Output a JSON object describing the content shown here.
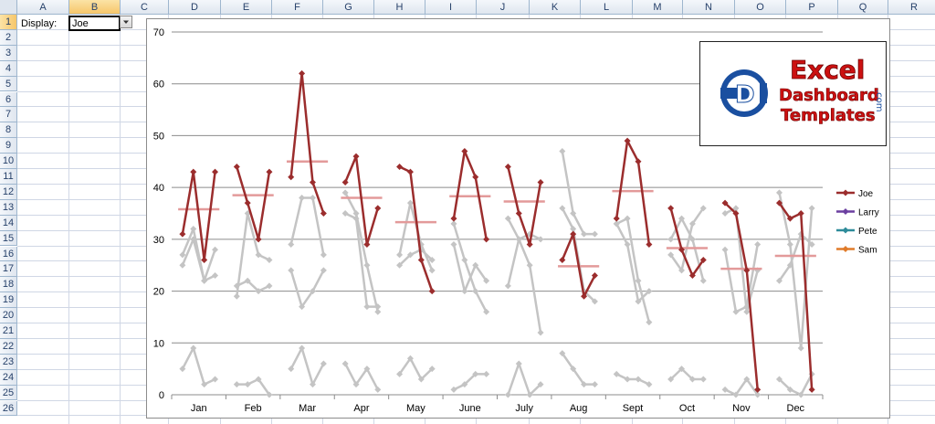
{
  "columns": [
    "A",
    "B",
    "C",
    "D",
    "E",
    "F",
    "G",
    "H",
    "I",
    "J",
    "K",
    "L",
    "M",
    "N",
    "O",
    "P",
    "Q",
    "R"
  ],
  "rows": [
    "1",
    "2",
    "3",
    "4",
    "5",
    "6",
    "7",
    "8",
    "9",
    "10",
    "11",
    "12",
    "13",
    "14",
    "15",
    "16",
    "17",
    "18",
    "19",
    "20",
    "21",
    "22",
    "23",
    "24",
    "25",
    "26"
  ],
  "active_column": "B",
  "active_row": "1",
  "cells": {
    "a1_label": "Display:",
    "b1_value": "Joe"
  },
  "dropdown_icon": "chevron-down-icon",
  "logo": {
    "line1": "Excel",
    "line2": "Dashboard",
    "line3": "Templates",
    "dotcom": ".com"
  },
  "colors": {
    "joe": "#9b2d2d",
    "avg": "#e39a9a",
    "grey": "#c4c4c4",
    "larry": "#6b3fa0",
    "pete": "#2e8b9a",
    "sam": "#e07b2a",
    "logo_red": "#cc1111",
    "logo_blue": "#1a4fa0"
  },
  "chart_data": {
    "type": "line",
    "ylim": [
      0,
      70
    ],
    "yticks": [
      "0",
      "10",
      "20",
      "30",
      "40",
      "50",
      "60",
      "70"
    ],
    "categories": [
      "Jan",
      "Feb",
      "Mar",
      "Apr",
      "May",
      "June",
      "July",
      "Aug",
      "Sept",
      "Oct",
      "Nov",
      "Dec"
    ],
    "legend": [
      "Joe",
      "Larry",
      "Pete",
      "Sam"
    ],
    "legend_position": "right",
    "grid": true,
    "highlighted_series": "Joe",
    "joe": [
      [
        31,
        43,
        26,
        43
      ],
      [
        44,
        37,
        30,
        43
      ],
      [
        42,
        62,
        41,
        35
      ],
      [
        41,
        46,
        29,
        36
      ],
      [
        44,
        43,
        26,
        20
      ],
      [
        34,
        47,
        42,
        30
      ],
      [
        44,
        35,
        29,
        41
      ],
      [
        26,
        31,
        19,
        23
      ],
      [
        34,
        49,
        45,
        29
      ],
      [
        36,
        28,
        23,
        26
      ],
      [
        37,
        35,
        24,
        1
      ],
      [
        37,
        34,
        35,
        1
      ]
    ],
    "joe_avg": [
      35.8,
      38.5,
      45,
      38,
      33.3,
      38.3,
      37.3,
      24.8,
      39.3,
      28.3,
      24.3,
      26.8
    ],
    "others": [
      [
        [
          27,
          32,
          22,
          28
        ],
        [
          25,
          30,
          22,
          23
        ],
        [
          5,
          9,
          2,
          3
        ]
      ],
      [
        [
          19,
          35,
          27,
          26
        ],
        [
          21,
          22,
          20,
          21
        ],
        [
          2,
          2,
          3,
          0
        ]
      ],
      [
        [
          29,
          38,
          38,
          27
        ],
        [
          24,
          17,
          20,
          24
        ],
        [
          5,
          9,
          2,
          6
        ]
      ],
      [
        [
          39,
          35,
          25,
          16
        ],
        [
          35,
          34,
          17,
          17
        ],
        [
          6,
          2,
          5,
          1
        ]
      ],
      [
        [
          27,
          37,
          29,
          24
        ],
        [
          25,
          27,
          28,
          26
        ],
        [
          4,
          7,
          3,
          5
        ]
      ],
      [
        [
          33,
          26,
          20,
          16
        ],
        [
          29,
          20,
          25,
          22
        ],
        [
          1,
          2,
          4,
          4
        ]
      ],
      [
        [
          34,
          30,
          25,
          12
        ],
        [
          21,
          30,
          31,
          30
        ],
        [
          0,
          6,
          0,
          2
        ]
      ],
      [
        [
          47,
          35,
          31,
          31
        ],
        [
          36,
          32,
          20,
          18
        ],
        [
          8,
          5,
          2,
          2
        ]
      ],
      [
        [
          33,
          34,
          22,
          14
        ],
        [
          33,
          29,
          18,
          20
        ],
        [
          4,
          3,
          3,
          2
        ]
      ],
      [
        [
          30,
          34,
          30,
          22
        ],
        [
          27,
          24,
          33,
          36
        ],
        [
          3,
          5,
          3,
          3
        ]
      ],
      [
        [
          35,
          36,
          16,
          24
        ],
        [
          28,
          16,
          17,
          29
        ],
        [
          1,
          0,
          3,
          0
        ]
      ],
      [
        [
          39,
          29,
          9,
          36
        ],
        [
          22,
          25,
          31,
          29
        ],
        [
          3,
          1,
          0,
          4
        ]
      ]
    ]
  }
}
